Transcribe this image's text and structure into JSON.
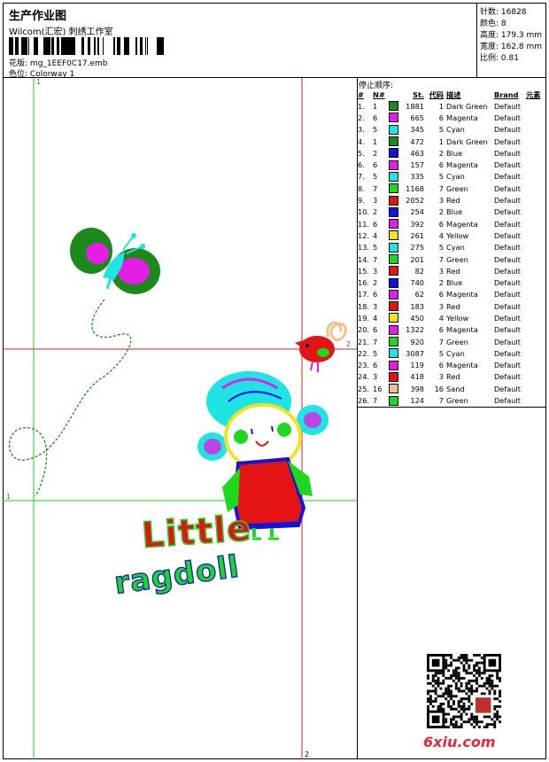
{
  "header": {
    "title": "生产作业图",
    "studio": "Wilcom(汇宏) 刺绣工作室",
    "file_label": "花版:",
    "file_name": "mg_1EEF0C17.emb",
    "colorway_label": "色位:",
    "colorway": "Colorway 1"
  },
  "stats": {
    "stitches": "针数: 16828",
    "colors": "颜色: 8",
    "height": "高度: 179.3 mm",
    "width": "宽度: 162.8 mm",
    "scale": "比例: 0.81"
  },
  "sequence": {
    "title": "停止顺序:",
    "headers": [
      "#",
      "N#",
      "St.",
      "代码",
      "描述",
      "Brand",
      "元素"
    ],
    "rows": [
      {
        "idx": "1.",
        "n": "1",
        "color": "#1b8a1b",
        "st": "1881",
        "code": "1",
        "desc": "Dark Green",
        "brand": "Default"
      },
      {
        "idx": "2.",
        "n": "6",
        "color": "#e41ee4",
        "st": "665",
        "code": "6",
        "desc": "Magenta",
        "brand": "Default"
      },
      {
        "idx": "3.",
        "n": "5",
        "color": "#1ee4e4",
        "st": "345",
        "code": "5",
        "desc": "Cyan",
        "brand": "Default"
      },
      {
        "idx": "4.",
        "n": "1",
        "color": "#1b8a1b",
        "st": "472",
        "code": "1",
        "desc": "Dark Green",
        "brand": "Default"
      },
      {
        "idx": "5.",
        "n": "2",
        "color": "#1414d8",
        "st": "463",
        "code": "2",
        "desc": "Blue",
        "brand": "Default"
      },
      {
        "idx": "6.",
        "n": "6",
        "color": "#e41ee4",
        "st": "157",
        "code": "6",
        "desc": "Magenta",
        "brand": "Default"
      },
      {
        "idx": "7.",
        "n": "5",
        "color": "#1ee4e4",
        "st": "335",
        "code": "5",
        "desc": "Cyan",
        "brand": "Default"
      },
      {
        "idx": "8.",
        "n": "7",
        "color": "#1ed81e",
        "st": "1168",
        "code": "7",
        "desc": "Green",
        "brand": "Default"
      },
      {
        "idx": "9.",
        "n": "3",
        "color": "#e41414",
        "st": "2052",
        "code": "3",
        "desc": "Red",
        "brand": "Default"
      },
      {
        "idx": "10.",
        "n": "2",
        "color": "#1414d8",
        "st": "254",
        "code": "2",
        "desc": "Blue",
        "brand": "Default"
      },
      {
        "idx": "11.",
        "n": "6",
        "color": "#e41ee4",
        "st": "392",
        "code": "6",
        "desc": "Magenta",
        "brand": "Default"
      },
      {
        "idx": "12.",
        "n": "4",
        "color": "#f0e41e",
        "st": "261",
        "code": "4",
        "desc": "Yellow",
        "brand": "Default"
      },
      {
        "idx": "13.",
        "n": "5",
        "color": "#1ee4e4",
        "st": "275",
        "code": "5",
        "desc": "Cyan",
        "brand": "Default"
      },
      {
        "idx": "14.",
        "n": "7",
        "color": "#1ed81e",
        "st": "201",
        "code": "7",
        "desc": "Green",
        "brand": "Default"
      },
      {
        "idx": "15.",
        "n": "3",
        "color": "#e41414",
        "st": "82",
        "code": "3",
        "desc": "Red",
        "brand": "Default"
      },
      {
        "idx": "16.",
        "n": "2",
        "color": "#1414d8",
        "st": "740",
        "code": "2",
        "desc": "Blue",
        "brand": "Default"
      },
      {
        "idx": "17.",
        "n": "6",
        "color": "#e41ee4",
        "st": "62",
        "code": "6",
        "desc": "Magenta",
        "brand": "Default"
      },
      {
        "idx": "18.",
        "n": "3",
        "color": "#e41414",
        "st": "183",
        "code": "3",
        "desc": "Red",
        "brand": "Default"
      },
      {
        "idx": "19.",
        "n": "4",
        "color": "#f0e41e",
        "st": "450",
        "code": "4",
        "desc": "Yellow",
        "brand": "Default"
      },
      {
        "idx": "20.",
        "n": "6",
        "color": "#e41ee4",
        "st": "1322",
        "code": "6",
        "desc": "Magenta",
        "brand": "Default"
      },
      {
        "idx": "21.",
        "n": "7",
        "color": "#1ed81e",
        "st": "920",
        "code": "7",
        "desc": "Green",
        "brand": "Default"
      },
      {
        "idx": "22.",
        "n": "5",
        "color": "#1ee4e4",
        "st": "3087",
        "code": "5",
        "desc": "Cyan",
        "brand": "Default"
      },
      {
        "idx": "23.",
        "n": "6",
        "color": "#e41ee4",
        "st": "119",
        "code": "6",
        "desc": "Magenta",
        "brand": "Default"
      },
      {
        "idx": "24.",
        "n": "3",
        "color": "#e41414",
        "st": "418",
        "code": "3",
        "desc": "Red",
        "brand": "Default"
      },
      {
        "idx": "25.",
        "n": "16",
        "color": "#f0c090",
        "st": "398",
        "code": "16",
        "desc": "Sand",
        "brand": "Default"
      },
      {
        "idx": "26.",
        "n": "7",
        "color": "#1ed81e",
        "st": "124",
        "code": "7",
        "desc": "Green",
        "brand": "Default"
      }
    ]
  },
  "design": {
    "text_line1": "Little",
    "text_line2": "ragdoll"
  },
  "guides": {
    "green_label_top": "1",
    "green_label_left": "1",
    "red_label_right": "2",
    "red_label_bottom": "2"
  },
  "footer": {
    "site_logo": "6xiu.com"
  }
}
